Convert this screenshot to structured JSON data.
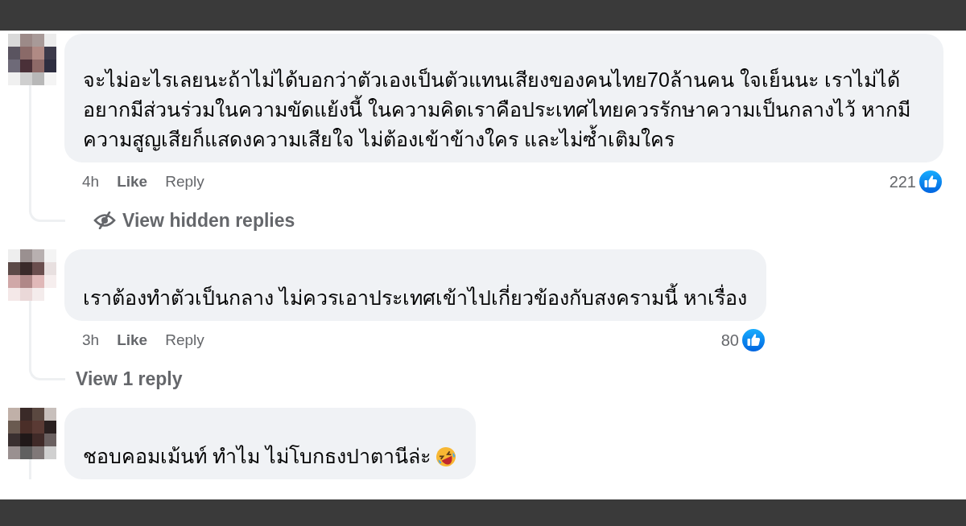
{
  "comments": [
    {
      "text": "จะไม่อะไรเลยนะถ้าไม่ได้บอกว่าตัวเองเป็นตัวแทนเสียงของคนไทย70ล้านคน ใจเย็นนะ เราไม่ได้อยากมีส่วนร่วมในความขัดแย้งนี้ ในความคิดเราคือประเทศไทยควรรักษาความเป็นกลางไว้ หากมีความสูญเสียก็แสดงความเสียใจ ไม่ต้องเข้าข้างใคร และไม่ซ้ำเติมใคร",
      "has_emoji": false,
      "time": "4h",
      "like": "Like",
      "reply": "Reply",
      "reactions": "221",
      "replies_link": {
        "kind": "hidden",
        "label": "View hidden replies"
      }
    },
    {
      "text": "เราต้องทำตัวเป็นกลาง ไม่ควรเอาประเทศเข้าไปเกี่ยวข้องกับสงครามนี้ หาเรื่อง",
      "has_emoji": false,
      "time": "3h",
      "like": "Like",
      "reply": "Reply",
      "reactions": "80",
      "replies_link": {
        "kind": "count",
        "label": "View 1 reply"
      }
    },
    {
      "text": "ชอบคอมเม้นท์ ทำไม ไม่โบกธงปาตานีล่ะ",
      "has_emoji": true
    }
  ]
}
